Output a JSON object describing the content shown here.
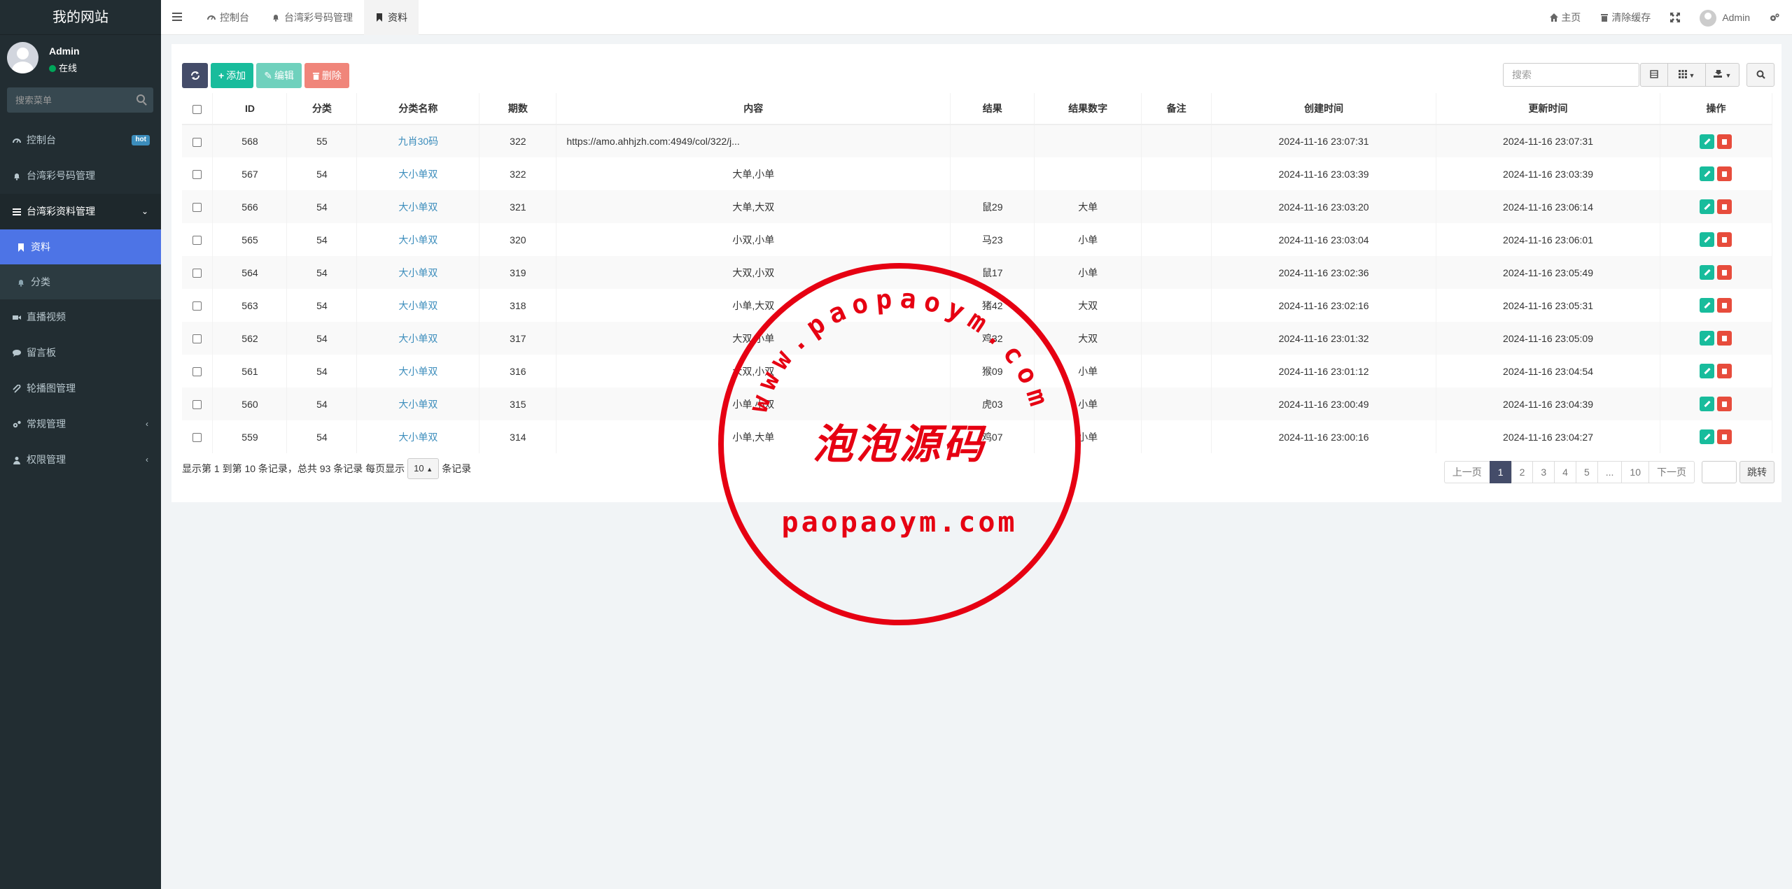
{
  "sidebar": {
    "brand": "我的网站",
    "user": {
      "name": "Admin",
      "status": "在线"
    },
    "search_placeholder": "搜索菜单",
    "items": [
      {
        "label": "控制台",
        "badge": "hot"
      },
      {
        "label": "台湾彩号码管理"
      },
      {
        "label": "台湾彩资料管理",
        "chevron": "⌄"
      },
      {
        "label": "资料"
      },
      {
        "label": "分类"
      },
      {
        "label": "直播视频"
      },
      {
        "label": "留言板"
      },
      {
        "label": "轮播图管理"
      },
      {
        "label": "常规管理",
        "chevron": "‹"
      },
      {
        "label": "权限管理",
        "chevron": "‹"
      }
    ]
  },
  "header": {
    "tabs": [
      {
        "label": "控制台"
      },
      {
        "label": "台湾彩号码管理"
      },
      {
        "label": "资料"
      }
    ],
    "home": "主页",
    "clear_cache": "清除缓存",
    "user": "Admin"
  },
  "toolbar": {
    "add": "添加",
    "edit": "编辑",
    "delete": "删除",
    "search_placeholder": "搜索"
  },
  "table": {
    "headers": [
      "ID",
      "分类",
      "分类名称",
      "期数",
      "内容",
      "结果",
      "结果数字",
      "备注",
      "创建时间",
      "更新时间",
      "操作"
    ],
    "rows": [
      {
        "id": "568",
        "cat": "55",
        "cat_name": "九肖30码",
        "period": "322",
        "content": "https://amo.ahhjzh.com:4949/col/322/j...",
        "result": "",
        "result_num": "",
        "note": "",
        "created": "2024-11-16 23:07:31",
        "updated": "2024-11-16 23:07:31"
      },
      {
        "id": "567",
        "cat": "54",
        "cat_name": "大小单双",
        "period": "322",
        "content": "大单,小单",
        "result": "",
        "result_num": "",
        "note": "",
        "created": "2024-11-16 23:03:39",
        "updated": "2024-11-16 23:03:39"
      },
      {
        "id": "566",
        "cat": "54",
        "cat_name": "大小单双",
        "period": "321",
        "content": "大单,大双",
        "result": "鼠29",
        "result_num": "大单",
        "note": "",
        "created": "2024-11-16 23:03:20",
        "updated": "2024-11-16 23:06:14"
      },
      {
        "id": "565",
        "cat": "54",
        "cat_name": "大小单双",
        "period": "320",
        "content": "小双,小单",
        "result": "马23",
        "result_num": "小单",
        "note": "",
        "created": "2024-11-16 23:03:04",
        "updated": "2024-11-16 23:06:01"
      },
      {
        "id": "564",
        "cat": "54",
        "cat_name": "大小单双",
        "period": "319",
        "content": "大双,小双",
        "result": "鼠17",
        "result_num": "小单",
        "note": "",
        "created": "2024-11-16 23:02:36",
        "updated": "2024-11-16 23:05:49"
      },
      {
        "id": "563",
        "cat": "54",
        "cat_name": "大小单双",
        "period": "318",
        "content": "小单,大双",
        "result": "猪42",
        "result_num": "大双",
        "note": "",
        "created": "2024-11-16 23:02:16",
        "updated": "2024-11-16 23:05:31"
      },
      {
        "id": "562",
        "cat": "54",
        "cat_name": "大小单双",
        "period": "317",
        "content": "大双,小单",
        "result": "鸡32",
        "result_num": "大双",
        "note": "",
        "created": "2024-11-16 23:01:32",
        "updated": "2024-11-16 23:05:09"
      },
      {
        "id": "561",
        "cat": "54",
        "cat_name": "大小单双",
        "period": "316",
        "content": "大双,小双",
        "result": "猴09",
        "result_num": "小单",
        "note": "",
        "created": "2024-11-16 23:01:12",
        "updated": "2024-11-16 23:04:54"
      },
      {
        "id": "560",
        "cat": "54",
        "cat_name": "大小单双",
        "period": "315",
        "content": "小单,小双",
        "result": "虎03",
        "result_num": "小单",
        "note": "",
        "created": "2024-11-16 23:00:49",
        "updated": "2024-11-16 23:04:39"
      },
      {
        "id": "559",
        "cat": "54",
        "cat_name": "大小单双",
        "period": "314",
        "content": "小单,大单",
        "result": "鸡07",
        "result_num": "小单",
        "note": "",
        "created": "2024-11-16 23:00:16",
        "updated": "2024-11-16 23:04:27"
      }
    ]
  },
  "footer": {
    "info_pre": "显示第 1 到第 10 条记录，总共 93 条记录 每页显示",
    "page_size": "10",
    "info_post": "条记录",
    "prev": "上一页",
    "pages": [
      "1",
      "2",
      "3",
      "4",
      "5",
      "...",
      "10"
    ],
    "next": "下一页",
    "jump": "跳转"
  },
  "watermark": {
    "arc_text": "www.paopaoym.com",
    "center_text": "泡泡源码",
    "bottom_text": "paopaoym.com",
    "color": "#e60012"
  },
  "colors": {
    "sidebar_bg": "#222d32",
    "active": "#4d74e6",
    "success": "#18bc9c",
    "danger": "#e74c3c",
    "primary_dark": "#444c69"
  }
}
